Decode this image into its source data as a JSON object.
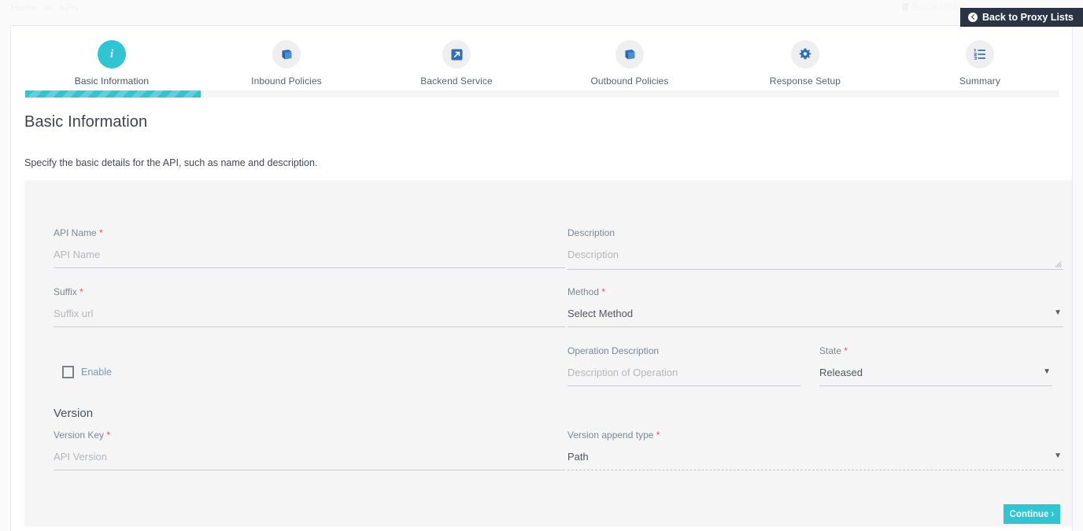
{
  "breadcrumb": {
    "home": "Home",
    "separator": "»",
    "current": "APIs"
  },
  "topbar": {
    "ghost_text": "BOOKMARK"
  },
  "back_button": {
    "label": "Back to Proxy Lists",
    "icon": "arrow-left-circle-icon"
  },
  "wizard": {
    "steps": [
      {
        "label": "Basic Information",
        "icon": "info-icon",
        "active": true
      },
      {
        "label": "Inbound Policies",
        "icon": "book-icon",
        "active": false
      },
      {
        "label": "Backend Service",
        "icon": "external-link-icon",
        "active": false
      },
      {
        "label": "Outbound Policies",
        "icon": "book-icon",
        "active": false
      },
      {
        "label": "Response Setup",
        "icon": "gear-icon",
        "active": false
      },
      {
        "label": "Summary",
        "icon": "ordered-list-icon",
        "active": false
      }
    ],
    "progress_percent": 17,
    "accent_color": "#30c5d2",
    "inactive_bubble_color": "#efefef",
    "step_icon_color": "#2f6fb5"
  },
  "page": {
    "title": "Basic Information",
    "subtitle": "Specify the basic details for the API, such as name and description."
  },
  "form": {
    "api_name": {
      "label": "API Name",
      "required": true,
      "placeholder": "API Name",
      "value": ""
    },
    "description": {
      "label": "Description",
      "required": false,
      "placeholder": "Description",
      "value": ""
    },
    "suffix": {
      "label": "Suffix",
      "required": true,
      "placeholder": "Suffix url",
      "value": ""
    },
    "method": {
      "label": "Method",
      "required": true,
      "value": "Select Method",
      "caret": "▼"
    },
    "enable": {
      "label": "Enable",
      "checked": false
    },
    "operation_description": {
      "label": "Operation Description",
      "required": false,
      "placeholder": "Description of Operation",
      "value": ""
    },
    "state": {
      "label": "State",
      "required": true,
      "value": "Released",
      "caret": "▼"
    },
    "version_section": {
      "title": "Version"
    },
    "version_key": {
      "label": "Version Key",
      "required": true,
      "placeholder": "API Version",
      "value": ""
    },
    "version_append_type": {
      "label": "Version append type",
      "required": true,
      "value": "Path",
      "caret": "▼",
      "disabled": true
    }
  },
  "footer": {
    "continue_label": "Continue",
    "continue_chevron": "›"
  }
}
